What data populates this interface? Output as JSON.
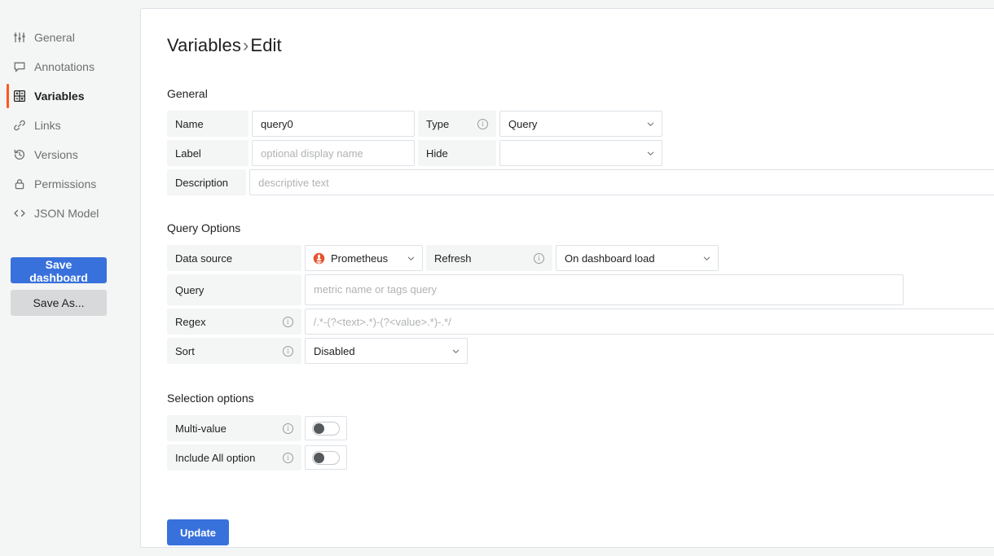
{
  "sidebar": {
    "items": [
      {
        "label": "General",
        "icon": "sliders-icon",
        "active": false
      },
      {
        "label": "Annotations",
        "icon": "comment-icon",
        "active": false
      },
      {
        "label": "Variables",
        "icon": "grid-icon",
        "active": true
      },
      {
        "label": "Links",
        "icon": "link-icon",
        "active": false
      },
      {
        "label": "Versions",
        "icon": "history-icon",
        "active": false
      },
      {
        "label": "Permissions",
        "icon": "lock-icon",
        "active": false
      },
      {
        "label": "JSON Model",
        "icon": "code-icon",
        "active": false
      }
    ],
    "save_dashboard_label": "Save dashboard",
    "save_as_label": "Save As..."
  },
  "page": {
    "title_parent": "Variables",
    "title_separator": "›",
    "title_current": "Edit"
  },
  "sections": {
    "general": "General",
    "query_options": "Query Options",
    "selection_options": "Selection options"
  },
  "general": {
    "name_label": "Name",
    "name_value": "query0",
    "type_label": "Type",
    "type_value": "Query",
    "label_label": "Label",
    "label_placeholder": "optional display name",
    "hide_label": "Hide",
    "hide_value": "",
    "description_label": "Description",
    "description_placeholder": "descriptive text"
  },
  "query_options": {
    "datasource_label": "Data source",
    "datasource_value": "Prometheus",
    "datasource_icon": "prometheus-icon",
    "refresh_label": "Refresh",
    "refresh_value": "On dashboard load",
    "query_label": "Query",
    "query_placeholder": "metric name or tags query",
    "regex_label": "Regex",
    "regex_placeholder": "/.*-(?<text>.*)-(?<value>.*)-.*/",
    "sort_label": "Sort",
    "sort_value": "Disabled"
  },
  "selection_options": {
    "multi_value_label": "Multi-value",
    "multi_value_on": false,
    "include_all_label": "Include All option",
    "include_all_on": false
  },
  "footer": {
    "update_label": "Update"
  },
  "colors": {
    "accent_blue": "#3871dc",
    "active_marker": "#ff5722",
    "prometheus_orange": "#e6522c",
    "panel_bg": "#ffffff",
    "app_bg": "#f4f5f5",
    "label_bg": "#f4f5f5",
    "border": "#dde1e6",
    "text": "#1f1f20",
    "muted_text": "#6e6e6e",
    "placeholder": "#b0b2b4"
  }
}
